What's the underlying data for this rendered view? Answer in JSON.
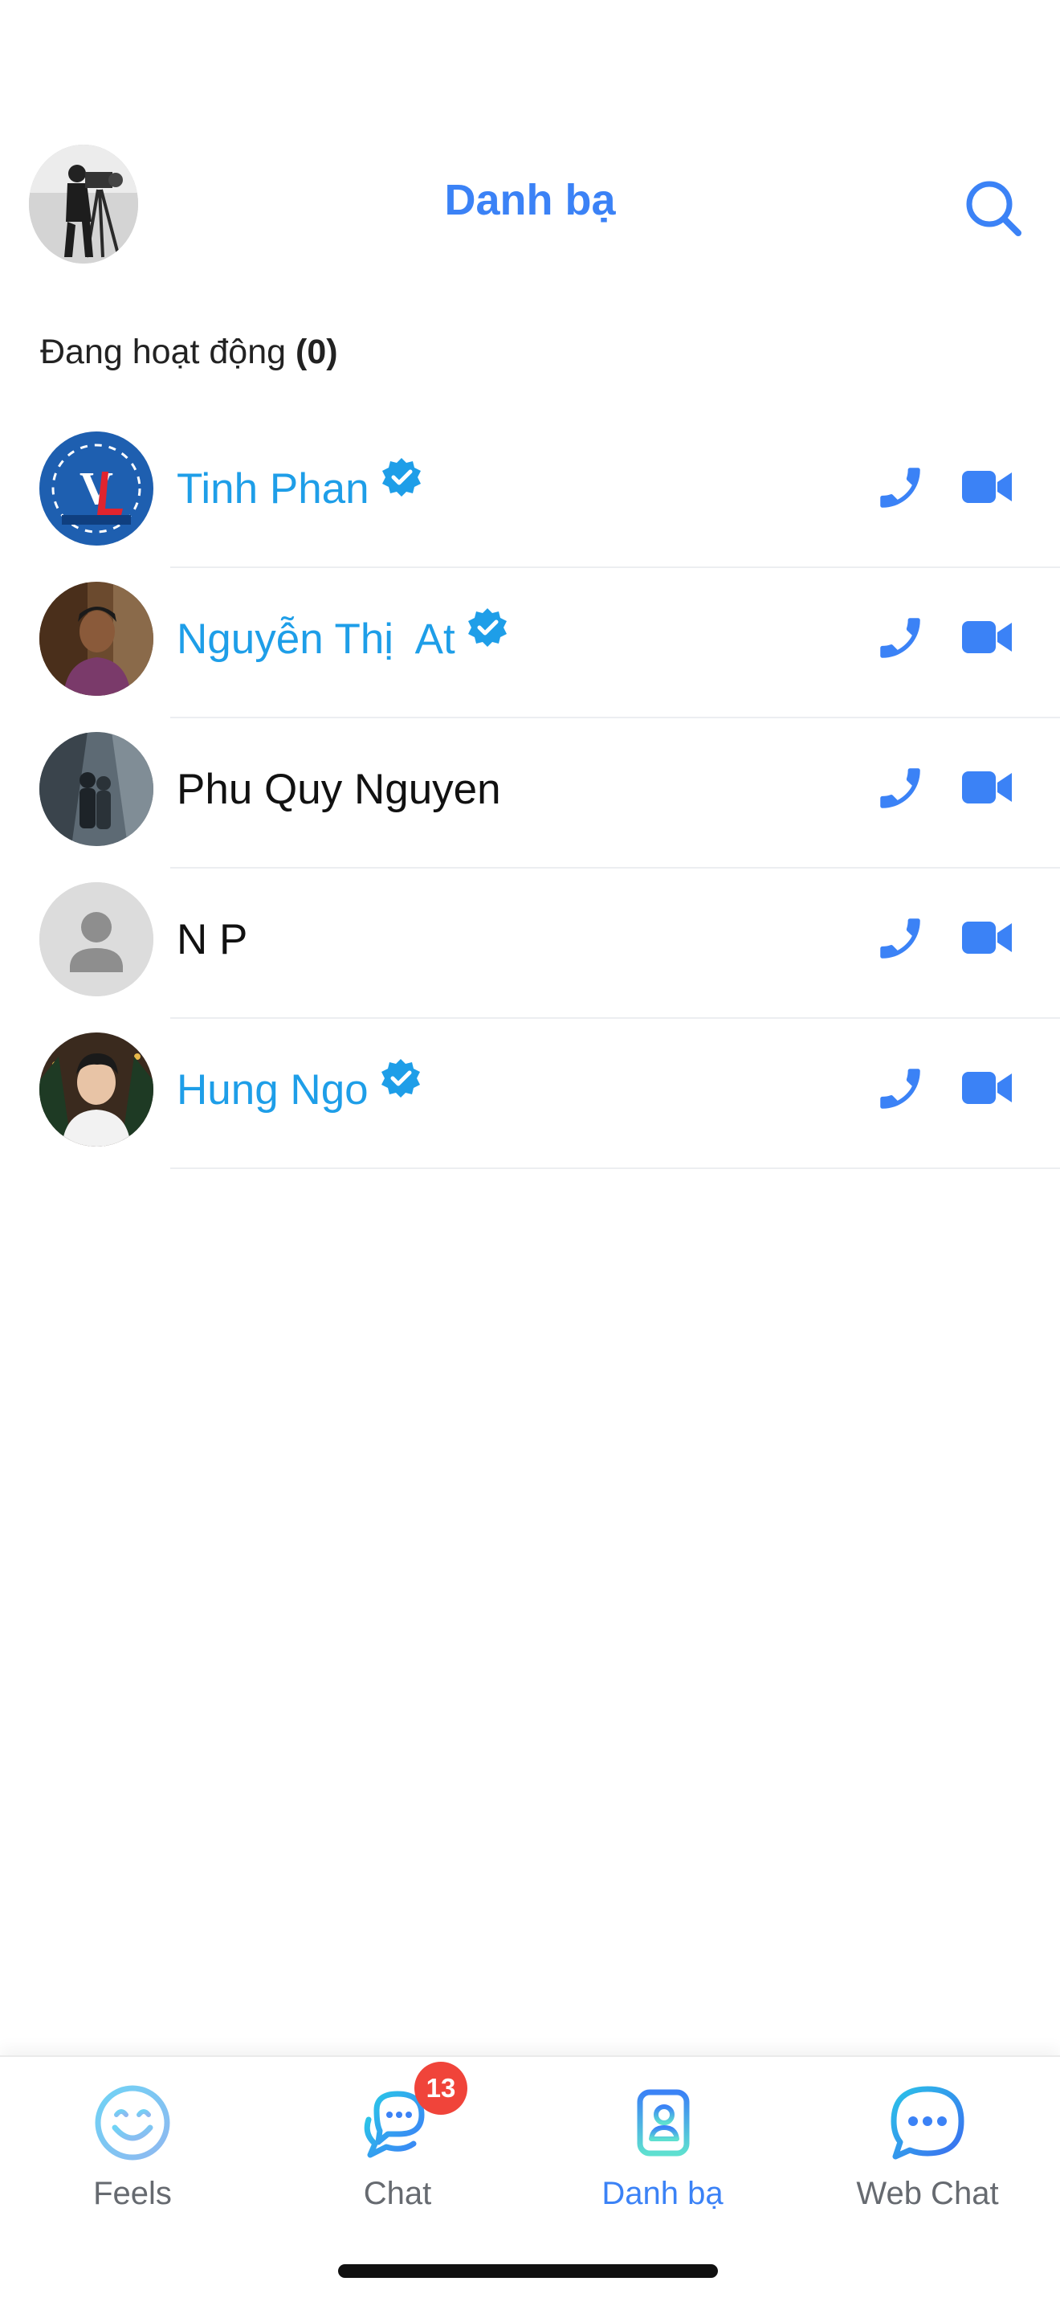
{
  "header": {
    "title": "Danh bạ",
    "search_icon": "search-icon",
    "profile_avatar": "photographer-camera-avatar"
  },
  "active_section": {
    "label": "Đang hoạt động",
    "count": "(0)"
  },
  "contacts": [
    {
      "name": "Tinh Phan",
      "verified": true,
      "avatar": "vl-logo-avatar"
    },
    {
      "name": "Nguyễn Thị  At",
      "verified": true,
      "avatar": "woman-portrait-avatar"
    },
    {
      "name": "Phu Quy Nguyen",
      "verified": false,
      "avatar": "couple-photo-avatar"
    },
    {
      "name": "N P",
      "verified": false,
      "avatar": "default-person-avatar"
    },
    {
      "name": "Hung Ngo",
      "verified": true,
      "avatar": "young-man-avatar"
    }
  ],
  "contact_actions": {
    "call_icon": "phone-icon",
    "video_icon": "video-camera-icon"
  },
  "bottom_nav": {
    "items": [
      {
        "label": "Feels",
        "icon": "smiley-icon"
      },
      {
        "label": "Chat",
        "icon": "chat-bubbles-icon",
        "badge": "13"
      },
      {
        "label": "Danh bạ",
        "icon": "contacts-book-icon",
        "active": true
      },
      {
        "label": "Web Chat",
        "icon": "web-chat-icon"
      }
    ]
  },
  "colors": {
    "accent": "#3b82f6",
    "verified_name": "#1e9ee8",
    "badge": "#f0443a",
    "inactive_label": "#666a70"
  }
}
